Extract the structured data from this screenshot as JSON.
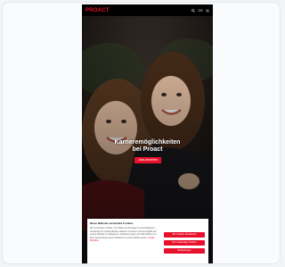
{
  "app": {
    "brand": "PROACT",
    "lang": "DE"
  },
  "hero": {
    "title_line1": "Karrieremöglichkeiten",
    "title_line2": "bei Proact",
    "button_label": "Jobs ansehen"
  },
  "cookie_banner": {
    "title": "Diese Website verwendet Cookies",
    "body": "Wir verwenden Cookies, um Inhalte und Anzeigen zu personalisieren, Funktionen für soziale Medien anbieten zu können und die Zugriffe auf unsere Website zu analysieren. Außerdem geben wir Informationen zu Ihrer Verwendung unserer Website an unsere Partner weiter.",
    "link_text": "Cookie-Richtlinie",
    "buttons": [
      "Alle Cookies akzeptieren",
      "Nur notwendige Cookies",
      "Einstellungen"
    ]
  },
  "colors": {
    "accent": "#e8112d",
    "topbar": "#000000"
  }
}
